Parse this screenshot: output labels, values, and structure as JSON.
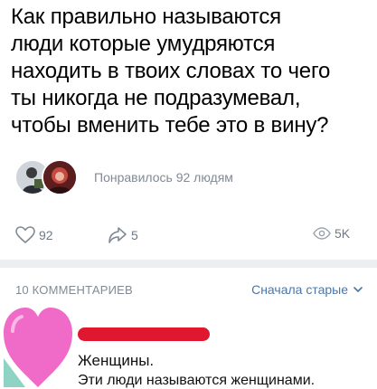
{
  "post": {
    "lines": [
      "Как правильно называются",
      "люди которые умудряются",
      "находить в твоих словах то чего",
      "ты никогда не подразумевал,",
      "чтобы вменить тебе это в вину?"
    ],
    "likers_text": "Понравилось 92 людям"
  },
  "actions": {
    "likes": "92",
    "shares": "5",
    "views": "5K",
    "like_icon": "heart-outline-icon",
    "share_icon": "share-arrow-icon",
    "views_icon": "eye-icon"
  },
  "comments": {
    "count_label": "10 КОММЕНТАРИЕВ",
    "sort_label": "Сначала старые",
    "items": [
      {
        "author_hidden": true,
        "lines": [
          "Женщины.",
          "Эти люди называются женщинами."
        ]
      }
    ]
  },
  "colors": {
    "link": "#4a76a8",
    "muted": "#828a94",
    "redaction": "#e0182f",
    "heart": "#f06ac8"
  }
}
